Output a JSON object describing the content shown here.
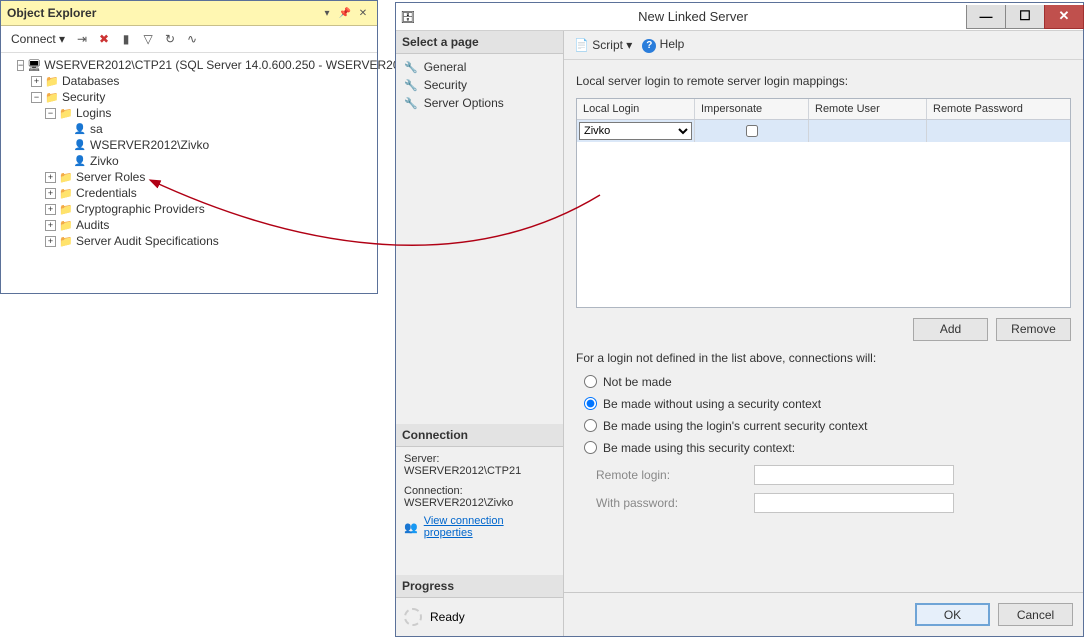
{
  "explorer": {
    "title": "Object Explorer",
    "connect_label": "Connect",
    "server": "WSERVER2012\\CTP21 (SQL Server 14.0.600.250 - WSERVER20",
    "nodes": {
      "databases": "Databases",
      "security": "Security",
      "logins": "Logins",
      "login_sa": "sa",
      "login_wserver": "WSERVER2012\\Zivko",
      "login_zivko": "Zivko",
      "server_roles": "Server Roles",
      "credentials": "Credentials",
      "crypto": "Cryptographic Providers",
      "audits": "Audits",
      "audit_specs": "Server Audit Specifications"
    }
  },
  "dialog": {
    "title": "New Linked Server",
    "sidebar": {
      "select_page": "Select a page",
      "pages": {
        "general": "General",
        "security": "Security",
        "server_options": "Server Options"
      },
      "connection_title": "Connection",
      "server_label": "Server:",
      "server_value": "WSERVER2012\\CTP21",
      "connection_label": "Connection:",
      "connection_value": "WSERVER2012\\Zivko",
      "view_conn_props": "View connection properties",
      "progress_title": "Progress",
      "progress_status": "Ready"
    },
    "toolbar": {
      "script": "Script",
      "help": "Help"
    },
    "mappings_label": "Local server login to remote server login mappings:",
    "grid": {
      "headers": {
        "local_login": "Local Login",
        "impersonate": "Impersonate",
        "remote_user": "Remote User",
        "remote_password": "Remote Password"
      },
      "row1": {
        "local_login": "Zivko",
        "impersonate": false,
        "remote_user": "",
        "remote_password": ""
      }
    },
    "buttons": {
      "add": "Add",
      "remove": "Remove",
      "ok": "OK",
      "cancel": "Cancel"
    },
    "not_defined_label": "For a login not defined in the list above, connections will:",
    "radios": {
      "not_made": "Not be made",
      "no_security": "Be made without using a security context",
      "current_ctx": "Be made using the login's current security context",
      "this_ctx": "Be made using this security context:"
    },
    "selected_radio": "no_security",
    "cred": {
      "remote_login_label": "Remote login:",
      "with_password_label": "With password:"
    }
  }
}
